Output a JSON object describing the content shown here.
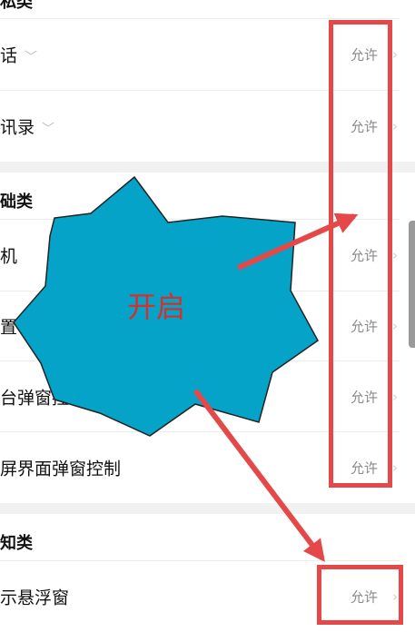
{
  "sections": {
    "privacy": {
      "title": "私类"
    },
    "basic": {
      "title": "础类"
    },
    "notification": {
      "title": "知类"
    }
  },
  "rows": {
    "call": {
      "label": "话",
      "value": "允许"
    },
    "contacts": {
      "label": "讯录",
      "value": "允许"
    },
    "boot": {
      "label": "机",
      "value": "允许"
    },
    "settings": {
      "label": "置",
      "value": "允许"
    },
    "background_popup": {
      "label": "台弹窗控制",
      "value": "允许"
    },
    "lockscreen_popup": {
      "label": "屏界面弹窗控制",
      "value": "允许"
    },
    "floating_window": {
      "label": "示悬浮窗",
      "value": "允许"
    }
  },
  "annotation": {
    "callout_text": "开启",
    "color": "#e54848",
    "star_color": "#06a3c8"
  },
  "icons": {
    "expand": "chevron-down-icon",
    "navigate": "chevron-right-icon"
  }
}
